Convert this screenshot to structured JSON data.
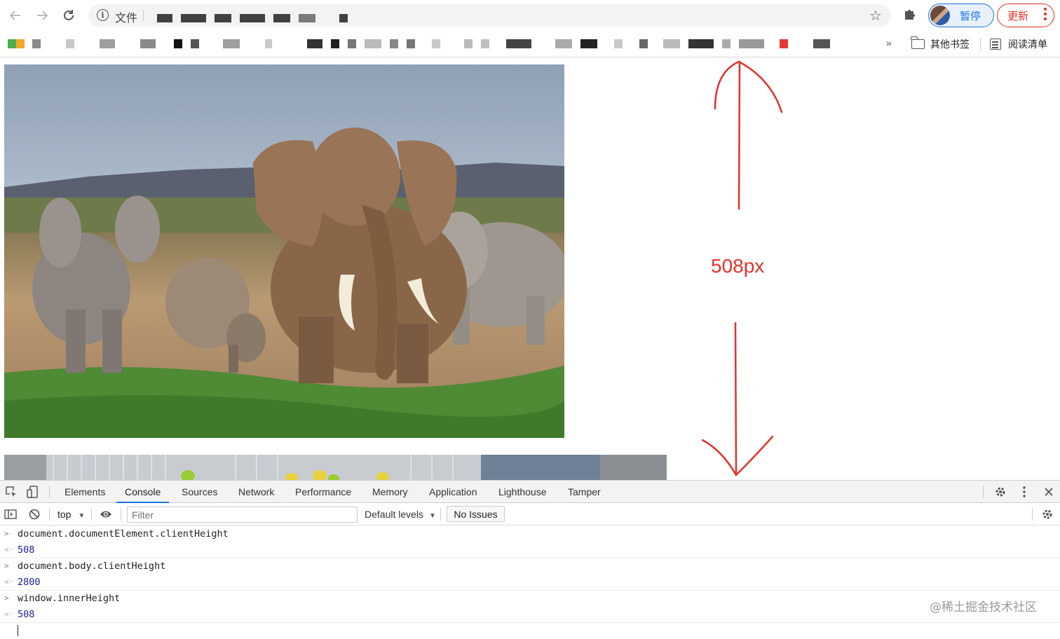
{
  "toolbar": {
    "omnibox_label": "文件",
    "profile_label": "暂停",
    "update_label": "更新"
  },
  "bookmarks": {
    "more": "»",
    "other_bookmarks": "其他书签",
    "reading_list": "阅读清单"
  },
  "page": {
    "annotation": "508px",
    "annotation_color": "#e5312b"
  },
  "devtools": {
    "tabs": [
      "Elements",
      "Console",
      "Sources",
      "Network",
      "Performance",
      "Memory",
      "Application",
      "Lighthouse",
      "Tamper"
    ],
    "active_tab": "Console",
    "context": "top",
    "filter_placeholder": "Filter",
    "levels": "Default levels",
    "issues": "No Issues",
    "console": [
      {
        "input": "document.documentElement.clientHeight",
        "output": "508"
      },
      {
        "input": "document.body.clientHeight",
        "output": "2800"
      },
      {
        "input": "window.innerHeight",
        "output": "508"
      }
    ]
  },
  "watermark": "@稀土掘金技术社区",
  "colors": {
    "accent": "#1a73e8",
    "update": "#d93025",
    "console_number": "#1c1c9c"
  }
}
